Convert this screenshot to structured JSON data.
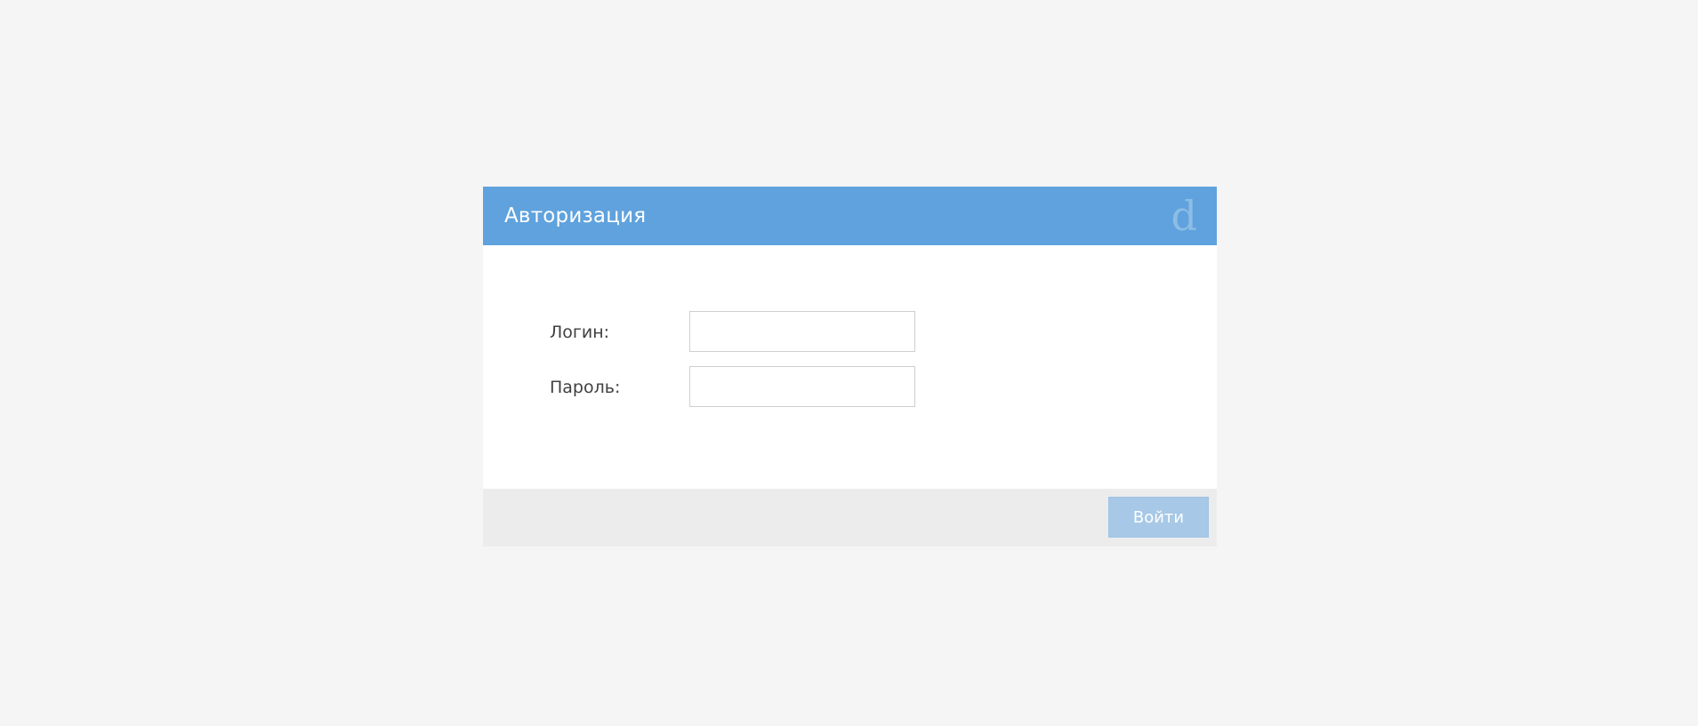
{
  "dialog": {
    "title": "Авторизация",
    "logo_letter": "d"
  },
  "form": {
    "login_label": "Логин:",
    "login_value": "",
    "password_label": "Пароль:",
    "password_value": ""
  },
  "footer": {
    "submit_label": "Войти"
  },
  "colors": {
    "header": "#5fa2dd",
    "button": "#a7c8e6",
    "footer": "#ececec",
    "page": "#f5f5f5"
  }
}
